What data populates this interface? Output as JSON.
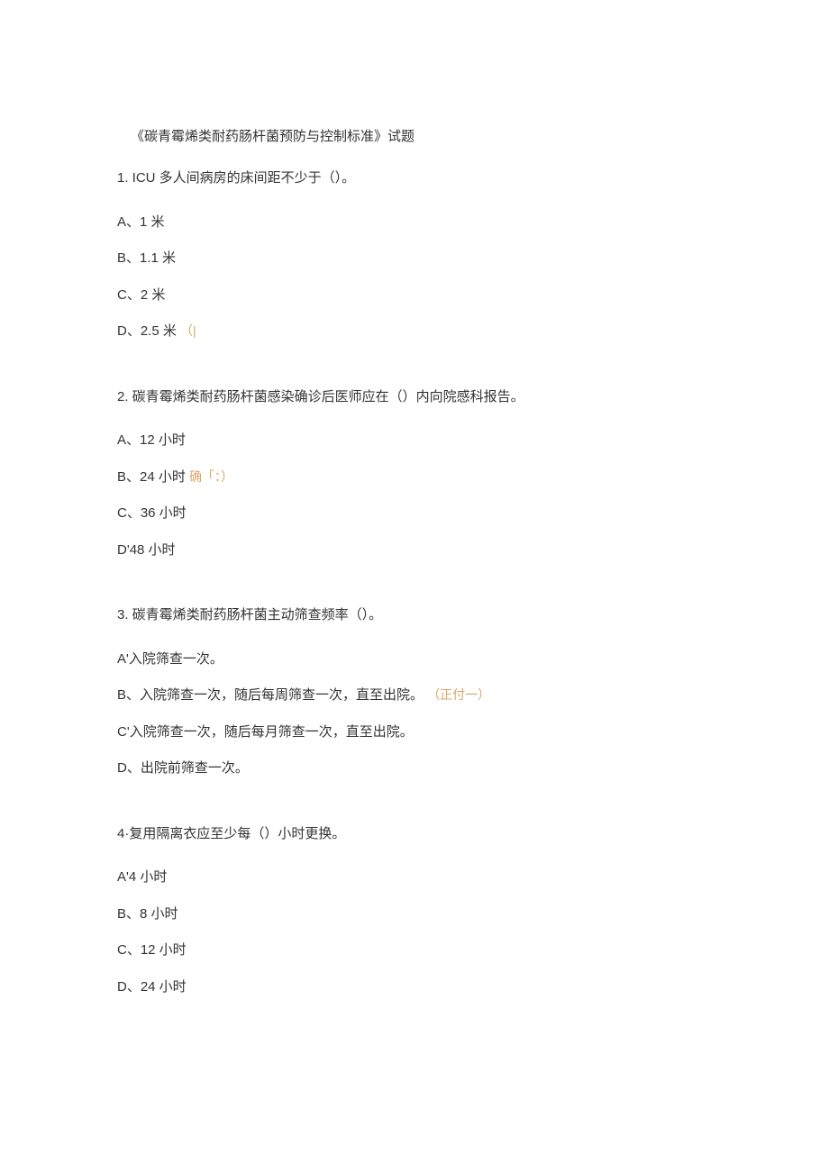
{
  "title": "《碳青霉烯类耐药肠杆菌预防与控制标准》试题",
  "q1": {
    "text": "1. ICU 多人间病房的床间距不少于（）。",
    "a": "A、1 米",
    "b": "B、1.1 米",
    "c": "C、2 米",
    "d": "D、2.5 米",
    "d_ann": "（|"
  },
  "q2": {
    "text": "2. 碳青霉烯类耐药肠杆菌感染确诊后医师应在（）内向院感科报告。",
    "a": "A、12 小时",
    "b": "B、24 小时",
    "b_ann": "确「：）",
    "c": "C、36 小时",
    "d": "D'48 小时"
  },
  "q3": {
    "text": "3. 碳青霉烯类耐药肠杆菌主动筛查频率（）。",
    "a": "A'入院筛查一次。",
    "b": "B、入院筛查一次，随后每周筛查一次，直至出院。",
    "b_ann": "（正付一）",
    "c": "C'入院筛查一次，随后每月筛查一次，直至出院。",
    "d": "D、出院前筛查一次。"
  },
  "q4": {
    "text": "4·复用隔离衣应至少每（）小时更换。",
    "a": "A'4 小时",
    "b": "B、8 小时",
    "c": "C、12 小时",
    "d": "D、24 小时"
  }
}
